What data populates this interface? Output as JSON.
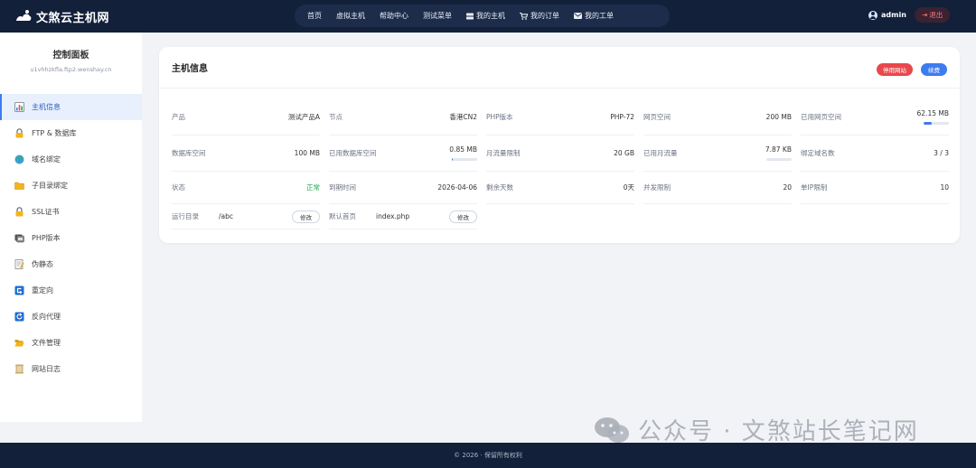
{
  "brand": {
    "name": "文煞云主机网"
  },
  "nav": {
    "items": [
      {
        "label": "首页",
        "icon": ""
      },
      {
        "label": "虚拟主机",
        "icon": ""
      },
      {
        "label": "帮助中心",
        "icon": ""
      },
      {
        "label": "测试菜单",
        "icon": ""
      },
      {
        "label": "我的主机",
        "icon": "server-icon"
      },
      {
        "label": "我的订单",
        "icon": "cart-icon"
      },
      {
        "label": "我的工单",
        "icon": "ticket-icon"
      }
    ]
  },
  "user": {
    "name": "admin",
    "logout_label": "退出"
  },
  "sidebar": {
    "title": "控制面板",
    "subtitle": "u1vhhzkfla.ftp2.wenshay.cn",
    "items": [
      {
        "label": "主机信息",
        "icon": "chart-icon",
        "active": true
      },
      {
        "label": "FTP & 数据库",
        "icon": "lock-icon",
        "active": false
      },
      {
        "label": "域名绑定",
        "icon": "globe-icon",
        "active": false
      },
      {
        "label": "子目录绑定",
        "icon": "folder-icon",
        "active": false
      },
      {
        "label": "SSL证书",
        "icon": "lock-icon",
        "active": false
      },
      {
        "label": "PHP版本",
        "icon": "php-icon",
        "active": false
      },
      {
        "label": "伪静态",
        "icon": "memo-icon",
        "active": false
      },
      {
        "label": "重定向",
        "icon": "redirect-icon",
        "active": false
      },
      {
        "label": "反向代理",
        "icon": "refresh-icon",
        "active": false
      },
      {
        "label": "文件管理",
        "icon": "folder-open-icon",
        "active": false
      },
      {
        "label": "网站日志",
        "icon": "scroll-icon",
        "active": false
      }
    ]
  },
  "card": {
    "title": "主机信息",
    "stop_label": "停用网站",
    "renew_label": "续费",
    "rows": [
      [
        {
          "label": "产品",
          "value": "测试产品A"
        },
        {
          "label": "节点",
          "value": "香港CN2"
        },
        {
          "label": "PHP版本",
          "value": "PHP-72"
        },
        {
          "label": "网页空间",
          "value": "200 MB"
        },
        {
          "label": "已用网页空间",
          "value": "62.15 MB",
          "usage": 0.31
        }
      ],
      [
        {
          "label": "数据库空间",
          "value": "100 MB"
        },
        {
          "label": "已用数据库空间",
          "value": "0.85 MB",
          "usage": 0.01
        },
        {
          "label": "月流量限制",
          "value": "20 GB"
        },
        {
          "label": "已用月流量",
          "value": "7.87 KB",
          "usage": 0.0
        },
        {
          "label": "绑定域名数",
          "value": "3 / 3"
        }
      ],
      [
        {
          "label": "状态",
          "value": "正常",
          "status": "ok"
        },
        {
          "label": "到期时间",
          "value": "2026-04-06"
        },
        {
          "label": "剩余天数",
          "value": "0天"
        },
        {
          "label": "并发限制",
          "value": "20"
        },
        {
          "label": "单IP限制",
          "value": "10"
        }
      ]
    ],
    "paths": [
      {
        "label": "运行目录",
        "value": "/abc",
        "button": "修改"
      },
      {
        "label": "默认首页",
        "value": "index.php",
        "button": "修改"
      }
    ]
  },
  "footer": {
    "text": "© 2026 · 保留所有权利"
  },
  "watermark": {
    "text": "公众号 · 文煞站长笔记网"
  },
  "colors": {
    "nav_bg": "#12203a",
    "accent": "#3d7cf0",
    "danger": "#e8484c",
    "success": "#22a34a"
  }
}
